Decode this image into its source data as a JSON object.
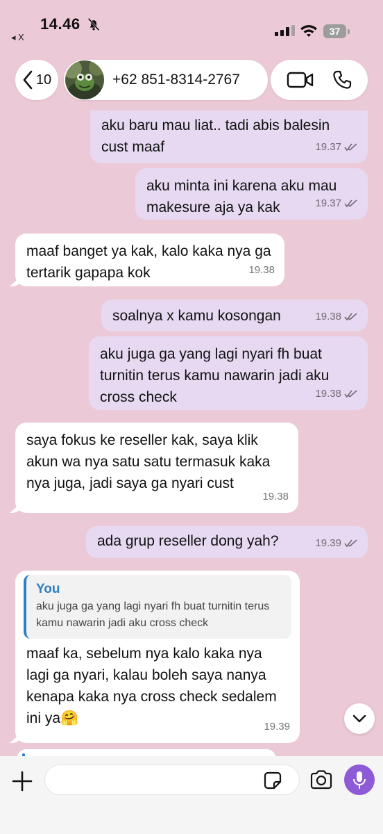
{
  "status_bar": {
    "time": "14.46",
    "back_app": "◂ X",
    "battery": "37"
  },
  "header": {
    "back_count": "10",
    "contact_name": "+62 851-8314-2767"
  },
  "messages": [
    {
      "dir": "out",
      "text": "aku baru mau liat.. tadi abis balesin cust maaf",
      "time": "19.37"
    },
    {
      "dir": "out",
      "text": "aku minta ini karena aku mau makesure aja ya kak",
      "time": "19.37"
    },
    {
      "dir": "in",
      "text": "maaf banget ya kak, kalo kaka nya ga tertarik gapapa kok",
      "time": "19.38"
    },
    {
      "dir": "out",
      "text": "soalnya x kamu kosongan",
      "time": "19.38"
    },
    {
      "dir": "out",
      "text": "aku juga ga yang lagi nyari fh buat turnitin terus kamu nawarin jadi aku cross check",
      "time": "19.38"
    },
    {
      "dir": "in",
      "text": "saya fokus ke reseller kak, saya klik akun wa nya satu satu termasuk kaka nya juga, jadi saya ga nyari cust",
      "time": "19.38"
    },
    {
      "dir": "out",
      "text": "ada grup reseller dong yah?",
      "time": "19.39"
    },
    {
      "dir": "in",
      "quote_name": "You",
      "quote_text": "aku juga ga yang lagi nyari fh buat turnitin terus kamu nawarin jadi aku cross check",
      "text": "maaf ka, sebelum nya kalo kaka nya lagi ga nyari, kalau boleh saya nanya kenapa kaka nya cross check sedalem ini ya🤗",
      "time": "19.39"
    }
  ],
  "composer": {
    "placeholder": ""
  },
  "colors": {
    "background": "#ecc9d6",
    "outgoing_bubble": "#e6d9f1",
    "incoming_bubble": "#ffffff",
    "accent": "#8e5bd6",
    "quote_accent": "#2f7fc2"
  },
  "icons": [
    "bell-slash-icon",
    "cellular-signal-icon",
    "wifi-icon",
    "battery-icon",
    "chevron-left-icon",
    "video-call-icon",
    "phone-icon",
    "double-check-icon",
    "chevron-down-icon",
    "plus-icon",
    "sticker-icon",
    "camera-icon",
    "microphone-icon"
  ]
}
